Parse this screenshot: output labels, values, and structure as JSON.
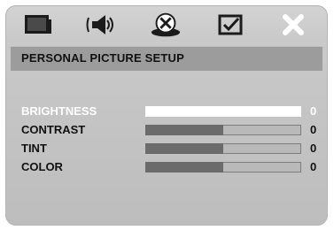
{
  "toolbar": {
    "icons": [
      "tv-screen-icon",
      "speaker-audio-icon",
      "picture-disc-icon",
      "check-preference-icon",
      "close-icon"
    ],
    "active_index": 2
  },
  "title": "PERSONAL PICTURE SETUP",
  "settings": [
    {
      "label": "BRIGHTNESS",
      "value": "0",
      "level": 0.5,
      "selected": true
    },
    {
      "label": "CONTRAST",
      "value": "0",
      "level": 0.5,
      "selected": false
    },
    {
      "label": "TINT",
      "value": "0",
      "level": 0.5,
      "selected": false
    },
    {
      "label": "COLOR",
      "value": "0",
      "level": 0.5,
      "selected": false
    }
  ],
  "colors": {
    "panel": "#c9c9c9",
    "title_bar": "#9c9c9c",
    "bar_fill": "#6b6b6b",
    "highlight": "#ffffff"
  }
}
